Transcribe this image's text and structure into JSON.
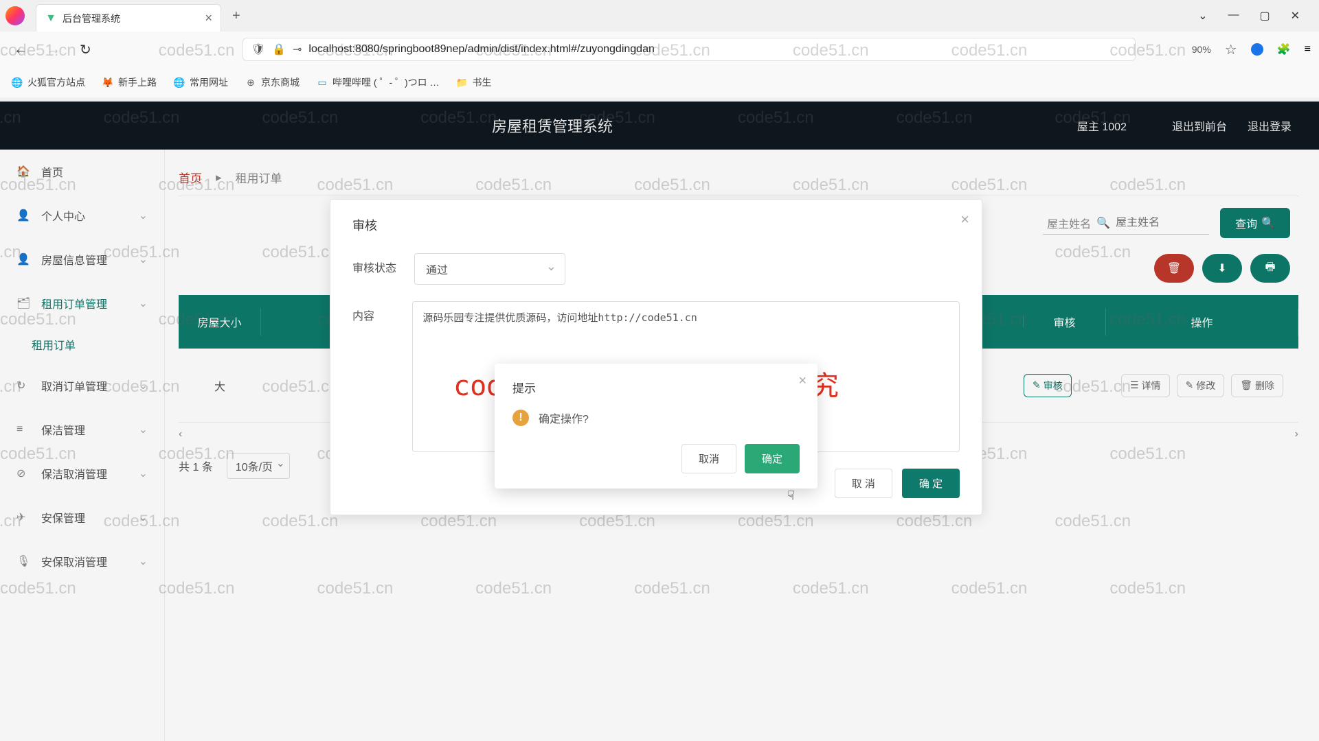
{
  "browser": {
    "tab_title": "后台管理系统",
    "url": "localhost:8080/springboot89nep/admin/dist/index.html#/zuyongdingdan",
    "zoom": "90%",
    "bookmarks": [
      "火狐官方站点",
      "新手上路",
      "常用网址",
      "京东商城",
      "哔哩哔哩 (  ゜- ゜)つロ …",
      "书生"
    ]
  },
  "header": {
    "title": "房屋租赁管理系统",
    "user": "屋主 1002",
    "link_front": "退出到前台",
    "link_logout": "退出登录"
  },
  "sidebar": {
    "items": [
      {
        "icon": "🏠",
        "label": "首页",
        "expandable": false
      },
      {
        "icon": "👤",
        "label": "个人中心",
        "expandable": true
      },
      {
        "icon": "👤",
        "label": "房屋信息管理",
        "expandable": true
      },
      {
        "icon": "🗂",
        "label": "租用订单管理",
        "expandable": true,
        "active": true,
        "sub": "租用订单"
      },
      {
        "icon": "↻",
        "label": "取消订单管理",
        "expandable": true
      },
      {
        "icon": "≡",
        "label": "保洁管理",
        "expandable": true
      },
      {
        "icon": "⊘",
        "label": "保洁取消管理",
        "expandable": true
      },
      {
        "icon": "✈",
        "label": "安保管理",
        "expandable": true
      },
      {
        "icon": "🎙",
        "label": "安保取消管理",
        "expandable": true
      }
    ]
  },
  "crumbs": {
    "home": "首页",
    "current": "租用订单"
  },
  "toolbar": {
    "search1_label": "屋主姓名",
    "search1_placeholder": "屋主姓名",
    "query": "查询"
  },
  "table": {
    "headers": [
      "房屋大小",
      "审核",
      "操作"
    ],
    "row": {
      "size": "大"
    },
    "ops": {
      "audit": "审核",
      "detail": "详情",
      "edit": "修改",
      "delete": "删除"
    },
    "total": "共 1 条",
    "page_size": "10条/页"
  },
  "dialog1": {
    "title": "审核",
    "status_label": "审核状态",
    "status_value": "通过",
    "content_label": "内容",
    "content_value": "源码乐园专注提供优质源码，访问地址http://code51.cn",
    "cancel": "取 消",
    "confirm": "确 定"
  },
  "dialog2": {
    "title": "提示",
    "message": "确定操作?",
    "cancel": "取消",
    "confirm": "确定"
  },
  "watermark": "code51.cn",
  "red_text": "code51.cn-源码乐园盗图必究"
}
